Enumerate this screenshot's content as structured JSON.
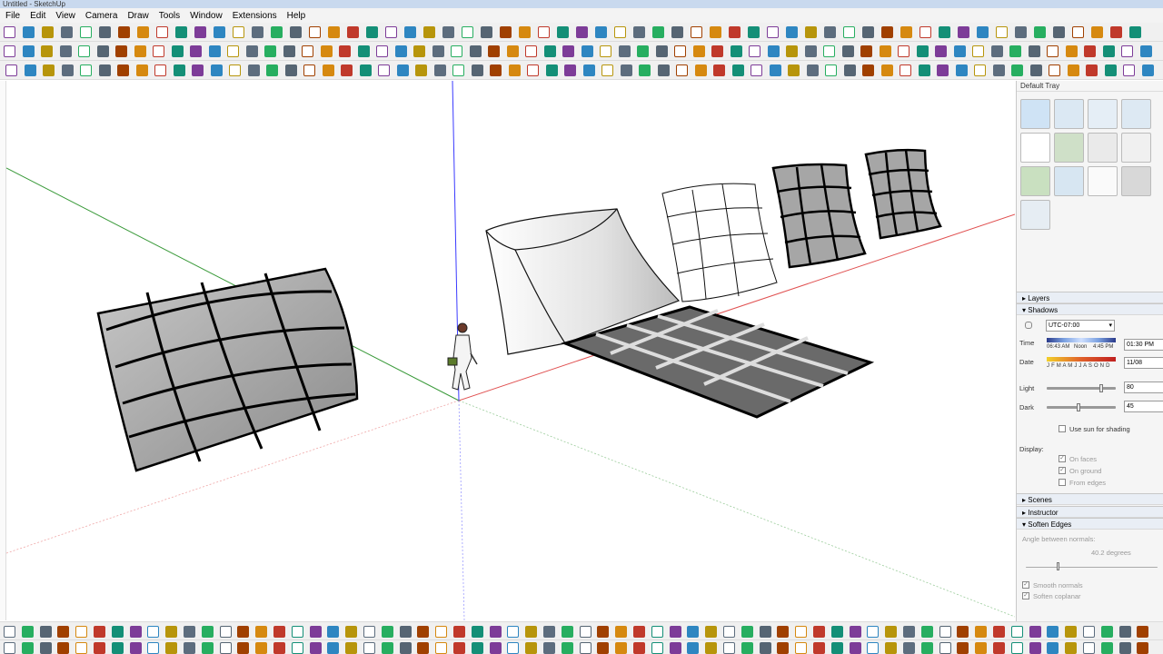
{
  "window": {
    "title": "Untitled - SketchUp"
  },
  "menu": [
    "File",
    "Edit",
    "View",
    "Camera",
    "Draw",
    "Tools",
    "Window",
    "Extensions",
    "Help"
  ],
  "tray": {
    "title": "Default Tray",
    "layers_label": "Layers",
    "shadows": {
      "label": "Shadows",
      "timezone": "UTC-07:00",
      "time_label": "Time",
      "time_sunrise": "06:43 AM",
      "time_noon": "Noon",
      "time_sunset": "4:45 PM",
      "time_value": "01:30 PM",
      "date_label": "Date",
      "months": "J F M A M J J A S O N D",
      "date_value": "11/08",
      "light_label": "Light",
      "light_value": "80",
      "dark_label": "Dark",
      "dark_value": "45",
      "use_sun_label": "Use sun for shading",
      "display_label": "Display:",
      "on_faces": "On faces",
      "on_ground": "On ground",
      "from_edges": "From edges"
    },
    "scenes_label": "Scenes",
    "instructor_label": "Instructor",
    "soften": {
      "label": "Soften Edges",
      "angle_label": "Angle between normals:",
      "angle_value": "40.2  degrees",
      "smooth_normals": "Smooth normals",
      "soften_coplanar": "Soften coplanar"
    }
  },
  "colors": {
    "axis_red": "#e05050",
    "axis_green": "#3a9a3a",
    "axis_blue": "#3a3aff",
    "panel_fill": "#a3a3a3",
    "grid_fill": "#6a6a6a"
  }
}
